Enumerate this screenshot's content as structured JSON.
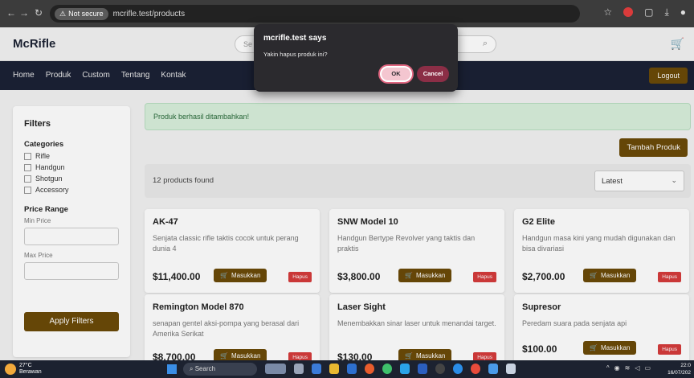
{
  "browser": {
    "security_label": "Not secure",
    "url": "mcrifle.test/products"
  },
  "header": {
    "logo": "McRifle",
    "search_placeholder": "Se"
  },
  "nav": {
    "items": [
      "Home",
      "Produk",
      "Custom",
      "Tentang",
      "Kontak"
    ],
    "logout": "Logout"
  },
  "sidebar": {
    "title": "Filters",
    "categories_title": "Categories",
    "categories": [
      "Rifle",
      "Handgun",
      "Shotgun",
      "Accessory"
    ],
    "price_title": "Price Range",
    "min_label": "Min Price",
    "max_label": "Max Price",
    "apply": "Apply Filters"
  },
  "main": {
    "alert": "Produk berhasil ditambahkan!",
    "add_button": "Tambah Produk",
    "found": "12 products found",
    "sort": "Latest"
  },
  "products": [
    {
      "name": "AK-47",
      "desc": "Senjata classic rifle taktis cocok untuk perang dunia 4",
      "price": "$11,400.00"
    },
    {
      "name": "SNW Model 10",
      "desc": "Handgun Bertype Revolver yang taktis dan praktis",
      "price": "$3,800.00"
    },
    {
      "name": "G2 Elite",
      "desc": "Handgun masa kini yang mudah digunakan dan bisa divariasi",
      "price": "$2,700.00"
    },
    {
      "name": "Remington Model 870",
      "desc": "senapan gentel aksi-pompa yang berasal dari Amerika Serikat",
      "price": "$8,700.00"
    },
    {
      "name": "Laser Sight",
      "desc": "Menembakkan sinar laser untuk menandai target.",
      "price": "$130.00"
    },
    {
      "name": "Supresor",
      "desc": "Peredam suara pada senjata api",
      "price": "$100.00"
    }
  ],
  "card_actions": {
    "add_cart": "Masukkan",
    "delete": "Hapus"
  },
  "dialog": {
    "title": "mcrifle.test says",
    "message": "Yakin hapus produk ini?",
    "ok": "OK",
    "cancel": "Cancel"
  },
  "taskbar": {
    "temp": "27°C",
    "weather": "Berawan",
    "search": "Search",
    "time": "22:0",
    "date": "16/07/202"
  }
}
